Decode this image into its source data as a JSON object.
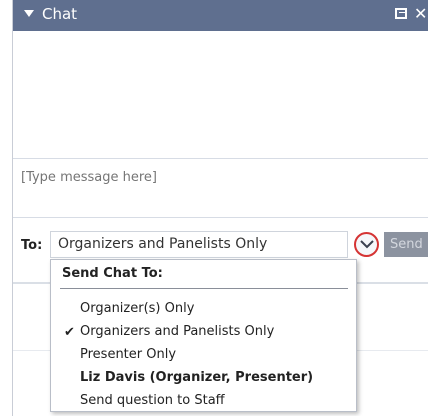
{
  "chat": {
    "title": "Chat",
    "message_placeholder": "[Type message here]",
    "to_label": "To:",
    "recipient_value": "Organizers and Panelists Only",
    "send_label": "Send"
  },
  "menu": {
    "header": "Send Chat To:",
    "items": [
      {
        "label": "Organizer(s) Only",
        "checked": false,
        "bold": false
      },
      {
        "label": "Organizers and Panelists Only",
        "checked": true,
        "bold": false
      },
      {
        "label": "Presenter Only",
        "checked": false,
        "bold": false
      },
      {
        "label": "Liz Davis (Organizer, Presenter)",
        "checked": false,
        "bold": true
      },
      {
        "label": "Send question to Staff",
        "checked": false,
        "bold": false
      }
    ]
  },
  "icons": {
    "collapse": "triangle-down-icon",
    "popout": "popout-icon",
    "close": "close-icon",
    "dropdown": "chevron-down-icon",
    "check": "checkmark-icon"
  },
  "colors": {
    "titlebar": "#5f6f8f",
    "highlight_circle": "#d53434",
    "send_button": "#8c93a0"
  }
}
